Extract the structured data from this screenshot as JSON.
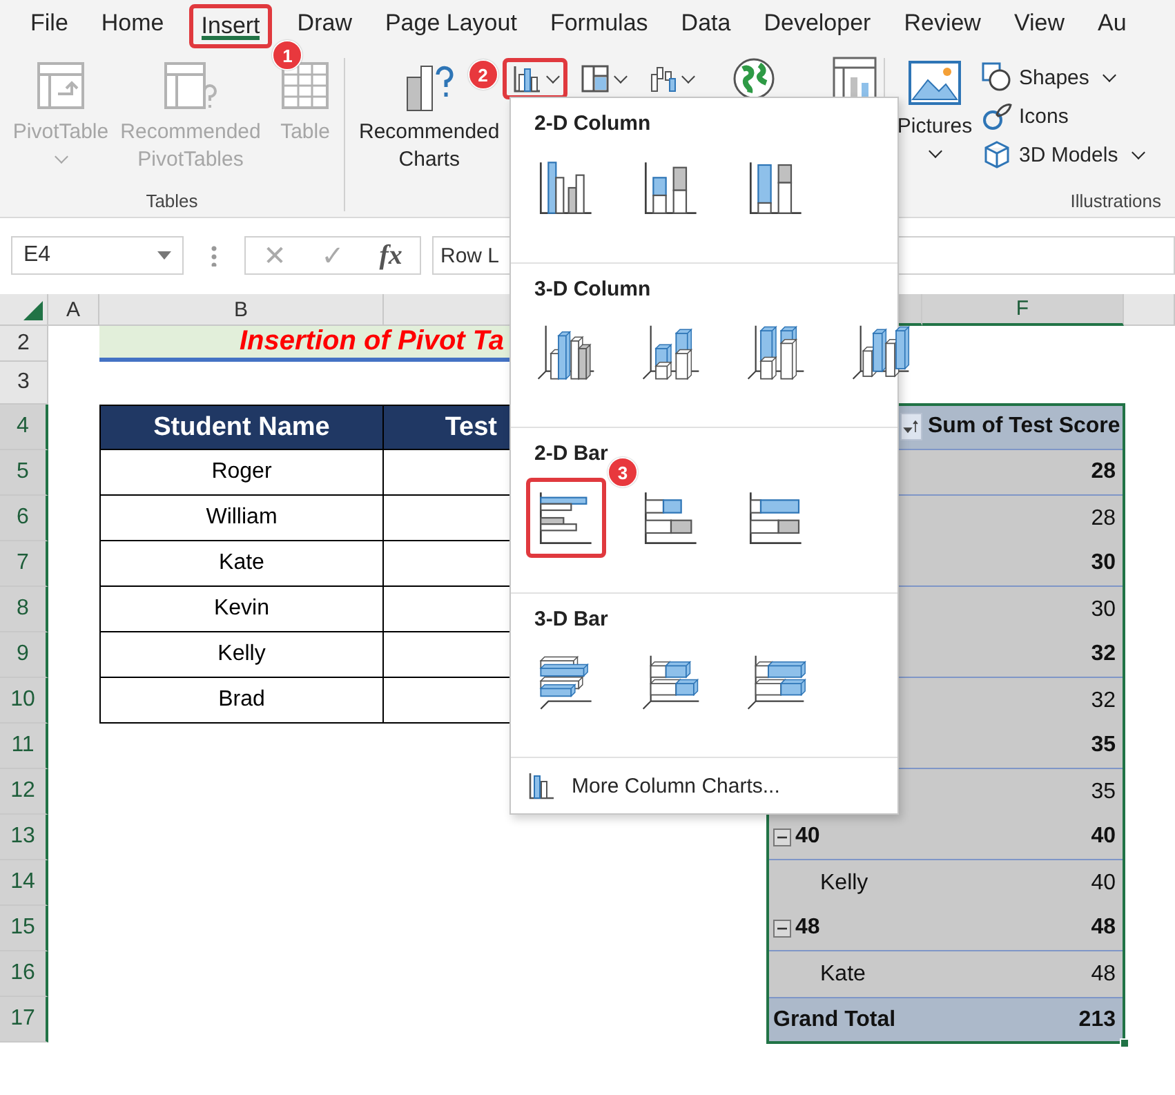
{
  "tabs": [
    {
      "label": "File",
      "selected": false
    },
    {
      "label": "Home",
      "selected": false
    },
    {
      "label": "Insert",
      "selected": true,
      "badge": "1"
    },
    {
      "label": "Draw",
      "selected": false
    },
    {
      "label": "Page Layout",
      "selected": false
    },
    {
      "label": "Formulas",
      "selected": false
    },
    {
      "label": "Data",
      "selected": false
    },
    {
      "label": "Developer",
      "selected": false
    },
    {
      "label": "Review",
      "selected": false
    },
    {
      "label": "View",
      "selected": false
    },
    {
      "label": "Au",
      "selected": false
    }
  ],
  "ribbon": {
    "tables": {
      "label": "Tables",
      "buttons": [
        {
          "kind": "pivot",
          "label": "PivotTable",
          "disabled": true
        },
        {
          "kind": "recpivot",
          "label": "Recommended PivotTables",
          "disabled": true
        },
        {
          "kind": "table",
          "label": "Table",
          "disabled": true
        }
      ]
    },
    "charts": {
      "recommended": {
        "label": "Recommended Charts"
      },
      "buttons": [
        {
          "kind": "column",
          "selected": true,
          "badge": "2"
        },
        {
          "kind": "hierarchy",
          "selected": false
        },
        {
          "kind": "waterfall",
          "selected": false
        },
        {
          "kind": "map",
          "selected": false
        },
        {
          "kind": "pivotchart",
          "selected": false
        }
      ]
    },
    "illustrations": {
      "label": "Illustrations",
      "pictures": {
        "label": "Pictures"
      },
      "items": [
        {
          "kind": "shapes",
          "label": "Shapes"
        },
        {
          "kind": "icons",
          "label": "Icons"
        },
        {
          "kind": "models",
          "label": "3D Models"
        }
      ]
    }
  },
  "formula_bar": {
    "name_box": "E4",
    "cancel": "✕",
    "enter": "✓",
    "function": "fx",
    "value": "Row L"
  },
  "sheet": {
    "column_headers": [
      {
        "label": "A",
        "selected": false
      },
      {
        "label": "B",
        "selected": false
      },
      {
        "label": "F",
        "selected": true
      }
    ],
    "row_headers": [
      "2",
      "3",
      "4",
      "5",
      "6",
      "7",
      "8",
      "9",
      "10",
      "11",
      "12",
      "13",
      "14",
      "15",
      "16",
      "17"
    ],
    "title": "Insertion of Pivot Ta",
    "student_table": {
      "columns": [
        "Student Name",
        "Test"
      ],
      "rows": [
        "Roger",
        "William",
        "Kate",
        "Kevin",
        "Kelly",
        "Brad"
      ]
    },
    "pivot": {
      "header": "Sum of Test Score",
      "rows": [
        {
          "kind": "group",
          "value": "28"
        },
        {
          "kind": "item",
          "value": "28"
        },
        {
          "kind": "group",
          "value": "30"
        },
        {
          "kind": "item",
          "value": "30"
        },
        {
          "kind": "group",
          "value": "32"
        },
        {
          "kind": "item",
          "value": "32"
        },
        {
          "kind": "group",
          "value": "35"
        },
        {
          "kind": "item",
          "value": "35"
        },
        {
          "kind": "group",
          "label": "40",
          "value": "40",
          "expanded": true
        },
        {
          "kind": "item",
          "label": "Kelly",
          "value": "40"
        },
        {
          "kind": "group",
          "label": "48",
          "value": "48",
          "expanded": true
        },
        {
          "kind": "item",
          "label": "Kate",
          "value": "48"
        },
        {
          "kind": "total",
          "label": "Grand Total",
          "value": "213"
        }
      ]
    }
  },
  "chart_menu": {
    "sections": [
      {
        "title": "2-D Column",
        "items": [
          {
            "kind": "clusteredcolumn",
            "selected": false
          },
          {
            "kind": "stackedcolumn",
            "selected": false
          },
          {
            "kind": "fullcolumn",
            "selected": false
          }
        ]
      },
      {
        "title": "3-D Column",
        "items": [
          {
            "kind": "clustered3dcolumn",
            "selected": false
          },
          {
            "kind": "stacked3dcolumn",
            "selected": false
          },
          {
            "kind": "full3dcolumn",
            "selected": false
          },
          {
            "kind": "column3d",
            "selected": false
          }
        ]
      },
      {
        "title": "2-D Bar",
        "items": [
          {
            "kind": "clusteredbar",
            "selected": true,
            "badge": "3"
          },
          {
            "kind": "stackedbar",
            "selected": false
          },
          {
            "kind": "fullbar",
            "selected": false
          }
        ]
      },
      {
        "title": "3-D Bar",
        "items": [
          {
            "kind": "clustered3dbar",
            "selected": false
          },
          {
            "kind": "stacked3dbar",
            "selected": false
          },
          {
            "kind": "full3dbar",
            "selected": false
          }
        ]
      }
    ],
    "more": "More Column Charts..."
  }
}
